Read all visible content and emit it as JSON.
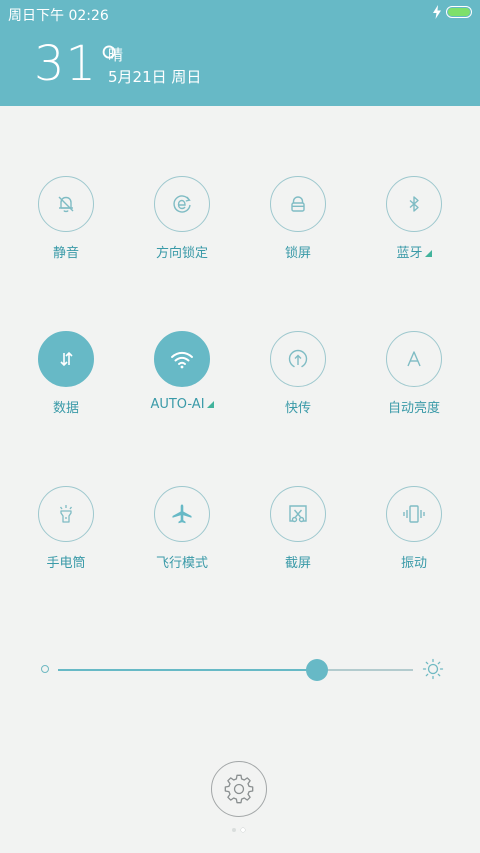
{
  "status_bar": {
    "time": "周日下午 02:26",
    "battery_level": 1.0,
    "charging": true,
    "battery_color": "#7ee06b"
  },
  "weather": {
    "temperature": "31°",
    "condition": "晴",
    "date": "5月21日 周日"
  },
  "toggles": [
    {
      "label": "静音",
      "icon": "bell-off-icon",
      "active": false,
      "has_menu": false
    },
    {
      "label": "方向锁定",
      "icon": "rotation-lock-icon",
      "active": false,
      "has_menu": false
    },
    {
      "label": "锁屏",
      "icon": "lock-icon",
      "active": false,
      "has_menu": false
    },
    {
      "label": "蓝牙",
      "icon": "bluetooth-icon",
      "active": false,
      "has_menu": true
    },
    {
      "label": "数据",
      "icon": "mobile-data-icon",
      "active": true,
      "has_menu": false
    },
    {
      "label": "AUTO-AI",
      "icon": "wifi-icon",
      "active": true,
      "has_menu": true
    },
    {
      "label": "快传",
      "icon": "quick-transfer-icon",
      "active": false,
      "has_menu": false
    },
    {
      "label": "自动亮度",
      "icon": "auto-brightness-icon",
      "active": false,
      "has_menu": false
    },
    {
      "label": "手电筒",
      "icon": "flashlight-icon",
      "active": false,
      "has_menu": false
    },
    {
      "label": "飞行模式",
      "icon": "airplane-icon",
      "active": false,
      "has_menu": false
    },
    {
      "label": "截屏",
      "icon": "screenshot-icon",
      "active": false,
      "has_menu": false
    },
    {
      "label": "振动",
      "icon": "vibrate-icon",
      "active": false,
      "has_menu": false
    }
  ],
  "brightness": {
    "level": 0.73
  },
  "settings": {
    "icon": "gear-icon"
  },
  "pager": {
    "count": 2,
    "current": 2
  },
  "colors": {
    "header": "#67b9c6",
    "accent": "#67b9c6",
    "label": "#3a9aa8",
    "menu_indicator": "#42b39c",
    "background": "#f2f3f2"
  }
}
